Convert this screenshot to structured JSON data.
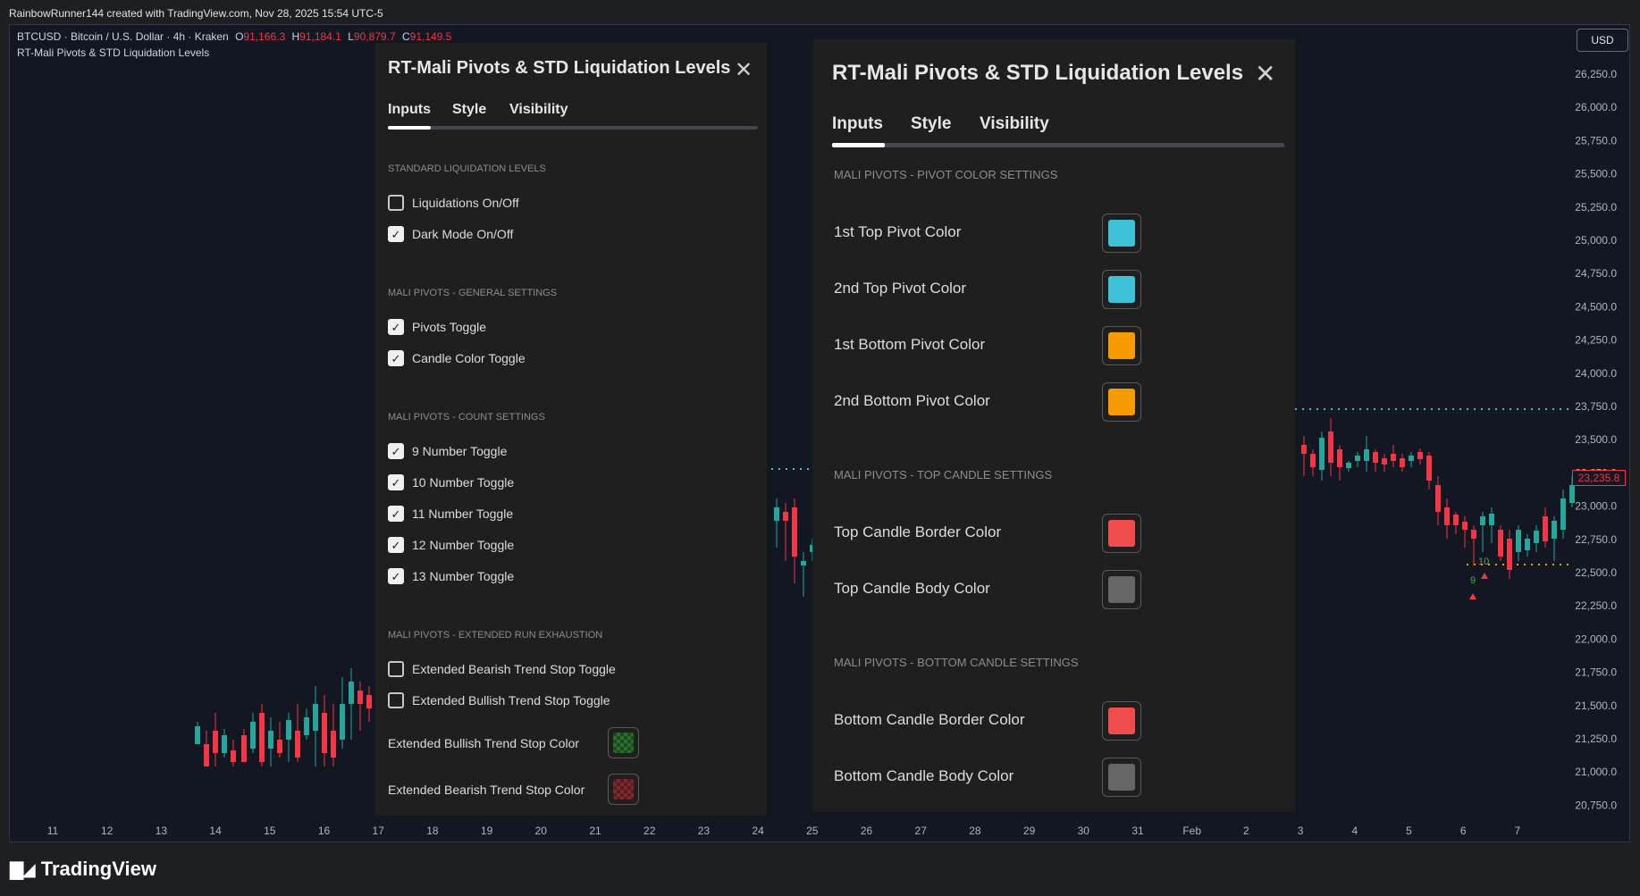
{
  "caption": "RainbowRunner144 created with TradingView.com, Nov 28, 2025 15:54 UTC-5",
  "symbol": {
    "name": "BTCUSD · Bitcoin / U.S. Dollar · 4h · Kraken",
    "o_label": "O",
    "o_value": "91,166.3",
    "h_label": "H",
    "h_value": "91,184.1",
    "l_label": "L",
    "l_value": "90,879.7",
    "c_label": "C",
    "c_value": "91,149.5"
  },
  "indicator_name": "RT-Mali Pivots & STD Liquidation Levels",
  "currency": "USD",
  "last_price": "23,235.8",
  "price_axis": [
    "26,250.0",
    "26,000.0",
    "25,750.0",
    "25,500.0",
    "25,250.0",
    "25,000.0",
    "24,750.0",
    "24,500.0",
    "24,250.0",
    "24,000.0",
    "23,750.0",
    "23,500.0",
    "23,250.0",
    "23,000.0",
    "22,750.0",
    "22,500.0",
    "22,250.0",
    "22,000.0",
    "21,750.0",
    "21,500.0",
    "21,250.0",
    "21,000.0",
    "20,750.0"
  ],
  "time_axis": [
    "11",
    "12",
    "13",
    "14",
    "15",
    "16",
    "17",
    "18",
    "19",
    "20",
    "21",
    "22",
    "23",
    "24",
    "25",
    "26",
    "27",
    "28",
    "29",
    "30",
    "31",
    "Feb",
    "2",
    "3",
    "4",
    "5",
    "6",
    "7"
  ],
  "pivot_labels": {
    "a": "10",
    "b": "9"
  },
  "brand": "TradingView",
  "colors": {
    "bull": "#26a69a",
    "bear": "#f23645",
    "cyan": "#3ec0d6",
    "orange": "#f59b00",
    "swatch_red": "#f14c4c",
    "swatch_gray": "#666666"
  },
  "panel_left": {
    "title": "RT-Mali Pivots & STD Liquidation Levels",
    "tabs": [
      "Inputs",
      "Style",
      "Visibility"
    ],
    "sections": {
      "s1": "STANDARD LIQUIDATION LEVELS",
      "s2": "MALI PIVOTS - GENERAL SETTINGS",
      "s3": "MALI PIVOTS - COUNT SETTINGS",
      "s4": "MALI PIVOTS - EXTENDED RUN EXHAUSTION"
    },
    "checkboxes": [
      {
        "label": "Liquidations On/Off",
        "checked": false
      },
      {
        "label": "Dark Mode On/Off",
        "checked": true
      },
      {
        "label": "Pivots Toggle",
        "checked": true
      },
      {
        "label": "Candle Color Toggle",
        "checked": true
      },
      {
        "label": "9 Number Toggle",
        "checked": true
      },
      {
        "label": "10 Number Toggle",
        "checked": true
      },
      {
        "label": "11 Number Toggle",
        "checked": true
      },
      {
        "label": "12 Number Toggle",
        "checked": true
      },
      {
        "label": "13 Number Toggle",
        "checked": true
      },
      {
        "label": "Extended Bearish Trend Stop Toggle",
        "checked": false
      },
      {
        "label": "Extended Bullish Trend Stop Toggle",
        "checked": false
      }
    ],
    "color_rows": [
      {
        "label": "Extended Bullish Trend Stop Color",
        "swatch": "checker-green"
      },
      {
        "label": "Extended Bearish Trend Stop Color",
        "swatch": "checker-red"
      }
    ]
  },
  "panel_right": {
    "title": "RT-Mali Pivots & STD Liquidation Levels",
    "tabs": [
      "Inputs",
      "Style",
      "Visibility"
    ],
    "sections": {
      "s1": "MALI PIVOTS - PIVOT COLOR SETTINGS",
      "s2": "MALI PIVOTS - TOP CANDLE SETTINGS",
      "s3": "MALI PIVOTS - BOTTOM CANDLE SETTINGS"
    },
    "color_rows": [
      {
        "label": "1st Top Pivot Color",
        "color": "#3ec0d6"
      },
      {
        "label": "2nd Top Pivot Color",
        "color": "#3ec0d6"
      },
      {
        "label": "1st Bottom Pivot Color",
        "color": "#f59b00"
      },
      {
        "label": "2nd Bottom Pivot Color",
        "color": "#f59b00"
      },
      {
        "label": "Top Candle Border Color",
        "color": "#f14c4c"
      },
      {
        "label": "Top Candle Body Color",
        "color": "#666666"
      },
      {
        "label": "Bottom Candle Border Color",
        "color": "#f14c4c"
      },
      {
        "label": "Bottom Candle Body Color",
        "color": "#666666"
      }
    ]
  }
}
